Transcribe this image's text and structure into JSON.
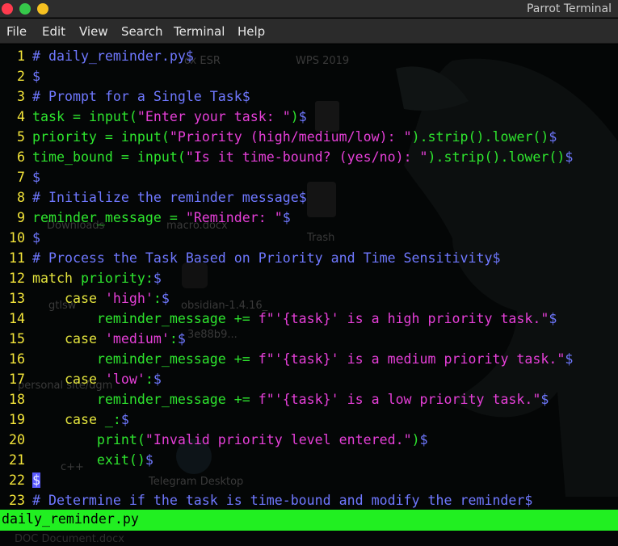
{
  "window": {
    "title": "Parrot Terminal"
  },
  "menu": [
    "File",
    "Edit",
    "View",
    "Search",
    "Terminal",
    "Help"
  ],
  "desktop_ghost_labels": [
    "ox ESR",
    "WPS 2019",
    "Trash",
    "Downloads",
    "macro.docx",
    "obsidian-1.4.16_",
    "3e88b9...",
    "personal site/dgm",
    "gtlsw",
    "c++",
    "Telegram Desktop",
    "DOC Document.docx"
  ],
  "code": {
    "eol_marker": "$",
    "lines": [
      {
        "num": "1",
        "segs": [
          {
            "t": "# daily_reminder.py",
            "c": "cm"
          }
        ]
      },
      {
        "num": "2",
        "segs": []
      },
      {
        "num": "3",
        "segs": [
          {
            "t": "# Prompt for a Single Task",
            "c": "cm"
          }
        ]
      },
      {
        "num": "4",
        "segs": [
          {
            "t": "task = ",
            "c": "id"
          },
          {
            "t": "input",
            "c": "fn"
          },
          {
            "t": "(",
            "c": "op"
          },
          {
            "t": "\"Enter your task: \"",
            "c": "str"
          },
          {
            "t": ")",
            "c": "op"
          }
        ]
      },
      {
        "num": "5",
        "segs": [
          {
            "t": "priority = ",
            "c": "id"
          },
          {
            "t": "input",
            "c": "fn"
          },
          {
            "t": "(",
            "c": "op"
          },
          {
            "t": "\"Priority (high/medium/low): \"",
            "c": "str"
          },
          {
            "t": ").strip().lower()",
            "c": "op"
          }
        ]
      },
      {
        "num": "6",
        "segs": [
          {
            "t": "time_bound = ",
            "c": "id"
          },
          {
            "t": "input",
            "c": "fn"
          },
          {
            "t": "(",
            "c": "op"
          },
          {
            "t": "\"Is it time-bound? (yes/no): \"",
            "c": "str"
          },
          {
            "t": ").strip().lower()",
            "c": "op"
          }
        ]
      },
      {
        "num": "7",
        "segs": []
      },
      {
        "num": "8",
        "segs": [
          {
            "t": "# Initialize the reminder message",
            "c": "cm"
          }
        ]
      },
      {
        "num": "9",
        "segs": [
          {
            "t": "reminder_message = ",
            "c": "id"
          },
          {
            "t": "\"Reminder: \"",
            "c": "str"
          }
        ]
      },
      {
        "num": "10",
        "segs": []
      },
      {
        "num": "11",
        "segs": [
          {
            "t": "# Process the Task Based on Priority and Time Sensitivity",
            "c": "cm"
          }
        ]
      },
      {
        "num": "12",
        "segs": [
          {
            "t": "match",
            "c": "kw"
          },
          {
            "t": " priority:",
            "c": "id"
          }
        ]
      },
      {
        "num": "13",
        "segs": [
          {
            "t": "    ",
            "c": "id"
          },
          {
            "t": "case",
            "c": "kw"
          },
          {
            "t": " ",
            "c": "id"
          },
          {
            "t": "'high'",
            "c": "str"
          },
          {
            "t": ":",
            "c": "id"
          }
        ]
      },
      {
        "num": "14",
        "segs": [
          {
            "t": "        reminder_message += ",
            "c": "id"
          },
          {
            "t": "f\"'{task}' is a high priority task.\"",
            "c": "str"
          }
        ]
      },
      {
        "num": "15",
        "segs": [
          {
            "t": "    ",
            "c": "id"
          },
          {
            "t": "case",
            "c": "kw"
          },
          {
            "t": " ",
            "c": "id"
          },
          {
            "t": "'medium'",
            "c": "str"
          },
          {
            "t": ":",
            "c": "id"
          }
        ]
      },
      {
        "num": "16",
        "segs": [
          {
            "t": "        reminder_message += ",
            "c": "id"
          },
          {
            "t": "f\"'{task}' is a medium priority task.\"",
            "c": "str"
          }
        ]
      },
      {
        "num": "17",
        "segs": [
          {
            "t": "    ",
            "c": "id"
          },
          {
            "t": "case",
            "c": "kw"
          },
          {
            "t": " ",
            "c": "id"
          },
          {
            "t": "'low'",
            "c": "str"
          },
          {
            "t": ":",
            "c": "id"
          }
        ]
      },
      {
        "num": "18",
        "segs": [
          {
            "t": "        reminder_message += ",
            "c": "id"
          },
          {
            "t": "f\"'{task}' is a low priority task.\"",
            "c": "str"
          }
        ]
      },
      {
        "num": "19",
        "segs": [
          {
            "t": "    ",
            "c": "id"
          },
          {
            "t": "case",
            "c": "kw"
          },
          {
            "t": " _:",
            "c": "id"
          }
        ]
      },
      {
        "num": "20",
        "segs": [
          {
            "t": "        print",
            "c": "fn"
          },
          {
            "t": "(",
            "c": "op"
          },
          {
            "t": "\"Invalid priority level entered.\"",
            "c": "str"
          },
          {
            "t": ")",
            "c": "op"
          }
        ]
      },
      {
        "num": "21",
        "segs": [
          {
            "t": "        exit()",
            "c": "fn"
          }
        ]
      },
      {
        "num": "22",
        "segs": [],
        "cursor": true
      },
      {
        "num": "23",
        "segs": [
          {
            "t": "# Determine if the task is time-bound and modify the reminder",
            "c": "cm"
          }
        ]
      }
    ]
  },
  "status": {
    "filename": "daily_reminder.py"
  },
  "colors": {
    "titlebar": "#2d2d2d",
    "status_green": "#21ef21",
    "comment": "#6f78ff",
    "keyword": "#e3e33d",
    "identifier": "#2ee52e",
    "string": "#e63fd8"
  }
}
